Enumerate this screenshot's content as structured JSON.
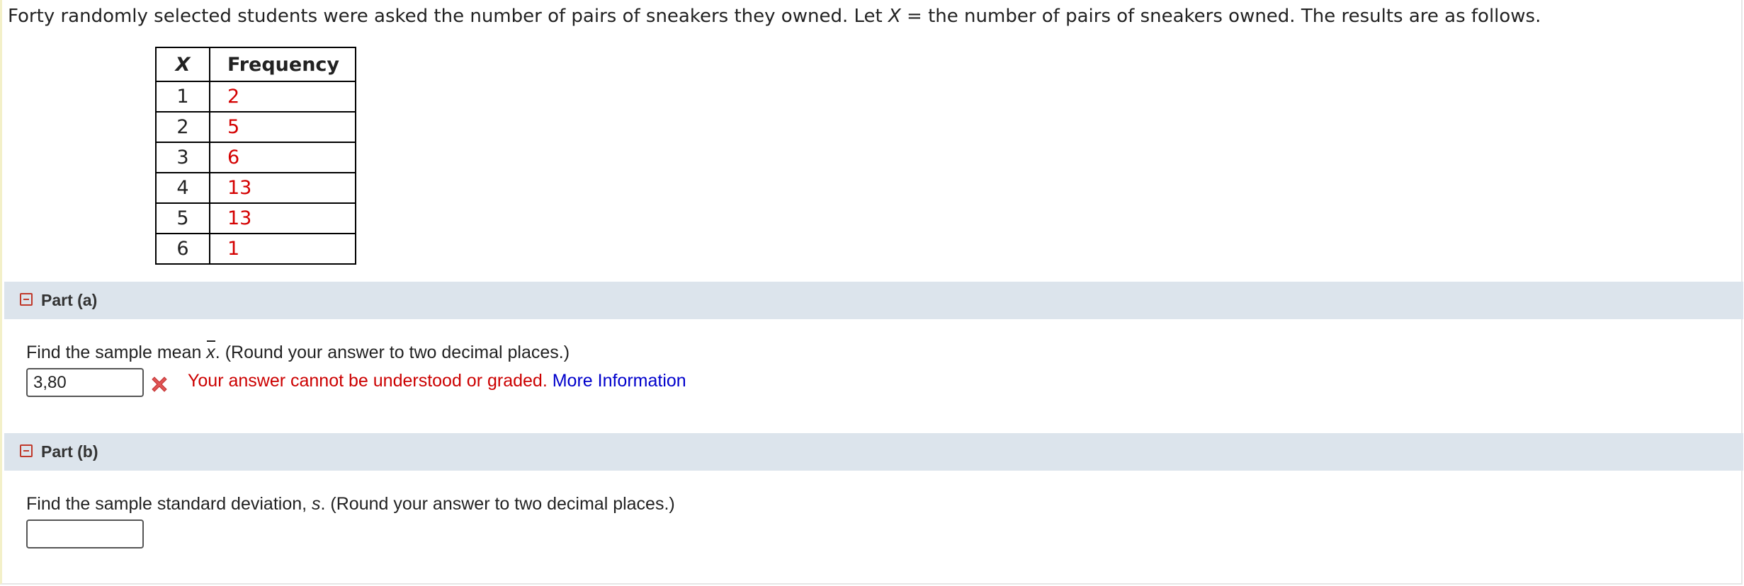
{
  "intro": {
    "text_before_var": "Forty randomly selected students were asked the number of pairs of sneakers they owned. Let ",
    "variable": "X",
    "text_after_var": " = the number of pairs of sneakers owned. The results are as follows."
  },
  "table": {
    "headers": [
      "X",
      "Frequency"
    ],
    "rows": [
      {
        "x": "1",
        "frequency": "2"
      },
      {
        "x": "2",
        "frequency": "5"
      },
      {
        "x": "3",
        "frequency": "6"
      },
      {
        "x": "4",
        "frequency": "13"
      },
      {
        "x": "5",
        "frequency": "13"
      },
      {
        "x": "6",
        "frequency": "1"
      }
    ]
  },
  "part_a": {
    "title": "Part (a)",
    "question_before": "Find the sample mean ",
    "symbol": "x",
    "question_after": ". (Round your answer to two decimal places.)",
    "answer_value": "3,80",
    "status_icon": "wrong-x-icon",
    "feedback": "Your answer cannot be understood or graded.",
    "more_info_link": "More Information"
  },
  "part_b": {
    "title": "Part (b)",
    "question_before": "Find the sample standard deviation, ",
    "symbol": "s",
    "question_after": ". (Round your answer to two decimal places.)",
    "answer_value": ""
  },
  "colors": {
    "header_bg": "#dce4ec",
    "error_red": "#cc0000",
    "frequency_red": "#d40000",
    "link_blue": "#0000cc"
  }
}
